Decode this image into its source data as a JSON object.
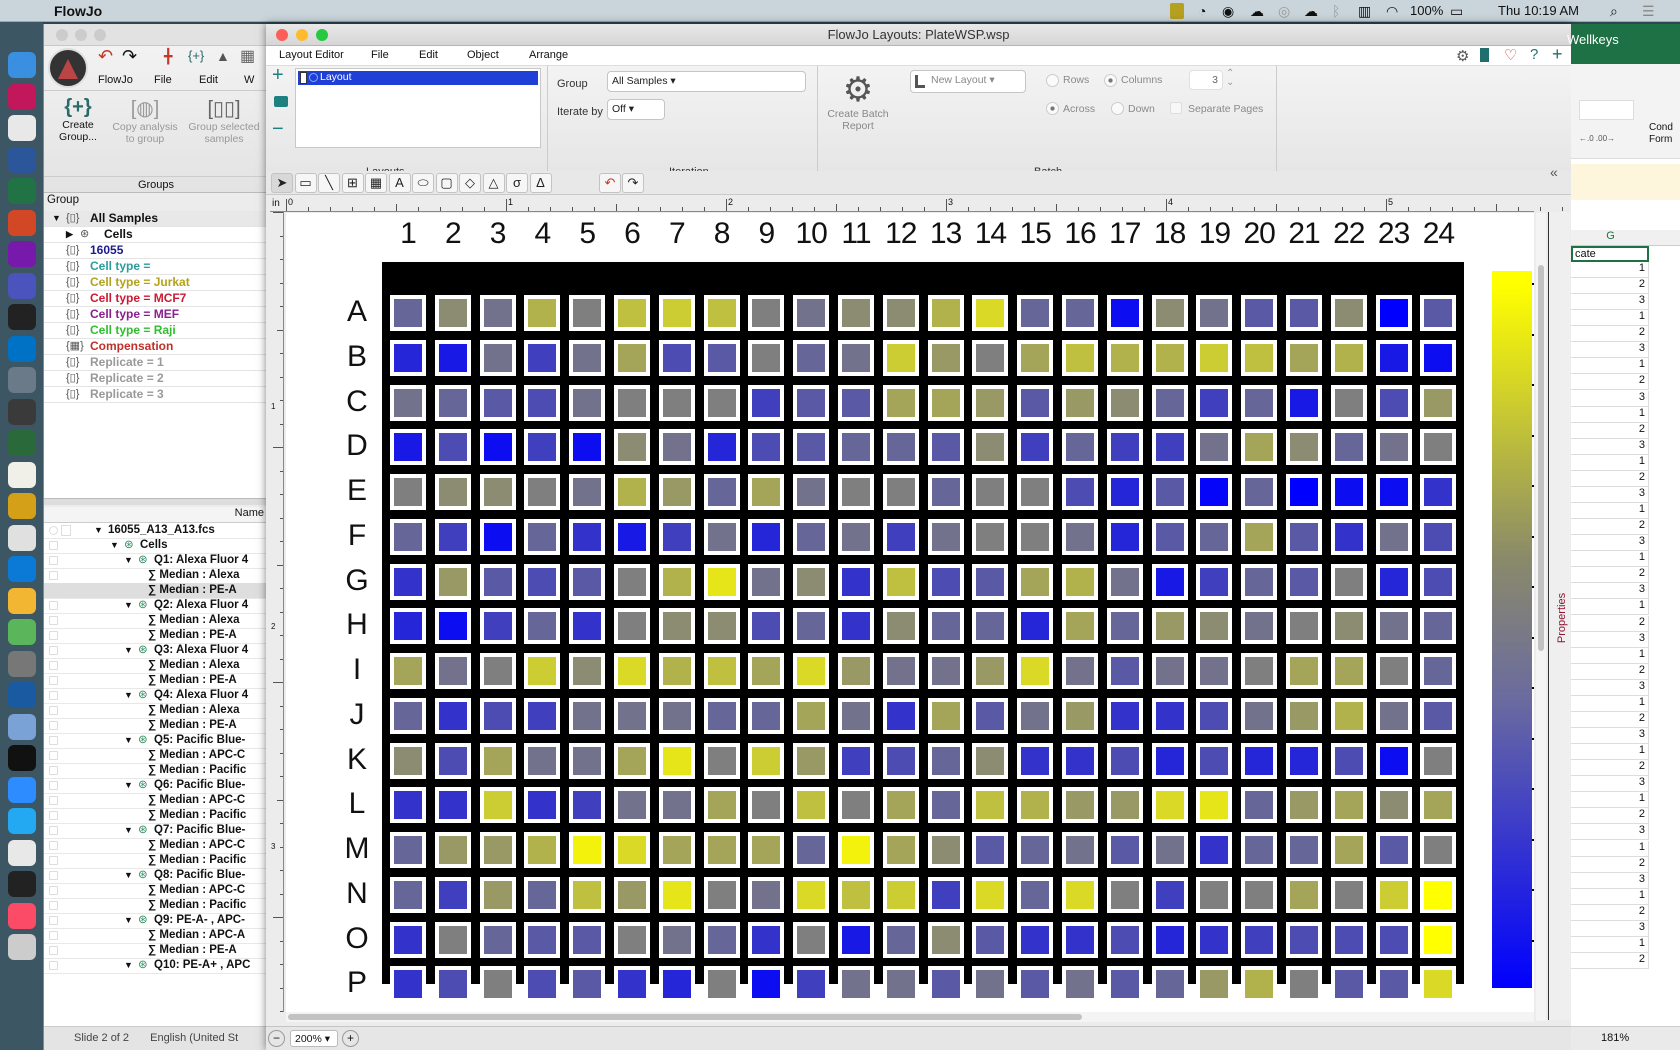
{
  "menubar": {
    "app_name": "FlowJo",
    "battery": "100%",
    "clock": "Thu 10:19 AM"
  },
  "dock": [
    {
      "name": "finder",
      "color": "#3b8fe0"
    },
    {
      "name": "heart-app",
      "color": "#c2185b"
    },
    {
      "name": "chrome",
      "color": "#e8e8e8"
    },
    {
      "name": "word",
      "color": "#2b579a"
    },
    {
      "name": "excel",
      "color": "#217346"
    },
    {
      "name": "powerpoint",
      "color": "#d24726"
    },
    {
      "name": "onenote",
      "color": "#7719aa"
    },
    {
      "name": "teams",
      "color": "#4b53bc"
    },
    {
      "name": "activity-monitor",
      "color": "#222"
    },
    {
      "name": "outlook",
      "color": "#0072c6"
    },
    {
      "name": "flowjo-stack",
      "color": "#6a7a88"
    },
    {
      "name": "flowjo",
      "color": "#3a3a3a"
    },
    {
      "name": "spreadsheet",
      "color": "#2a6a3a"
    },
    {
      "name": "notes",
      "color": "#f0f0e8"
    },
    {
      "name": "ubar",
      "color": "#d4a017"
    },
    {
      "name": "books",
      "color": "#e0e0e0"
    },
    {
      "name": "onedrive",
      "color": "#0a7ad6"
    },
    {
      "name": "photos",
      "color": "#f2b632"
    },
    {
      "name": "cloud",
      "color": "#5bb55a"
    },
    {
      "name": "system-preferences",
      "color": "#777"
    },
    {
      "name": "quicktime",
      "color": "#1a5aa0"
    },
    {
      "name": "r",
      "color": "#7aa2d6"
    },
    {
      "name": "terminal",
      "color": "#111"
    },
    {
      "name": "zoom",
      "color": "#2d8cff"
    },
    {
      "name": "vscode",
      "color": "#23a9f2"
    },
    {
      "name": "slack",
      "color": "#e8e8e8"
    },
    {
      "name": "acrobat",
      "color": "#222"
    },
    {
      "name": "music",
      "color": "#fb4b67"
    },
    {
      "name": "trash",
      "color": "#ccc"
    }
  ],
  "flowjo": {
    "menu": [
      "FlowJo",
      "File",
      "Edit",
      "W"
    ],
    "groups_ribbon": {
      "create": "Create Group...",
      "copy": "Copy analysis to group",
      "group_selected": "Group selected samples",
      "label": "Groups"
    },
    "group_header": "Group",
    "groups": [
      {
        "label": "All Samples",
        "color": "#111",
        "indent": 0,
        "arrow": "down",
        "icon": "group"
      },
      {
        "label": "Cells",
        "color": "#111",
        "indent": 1,
        "arrow": "right",
        "icon": "gate"
      },
      {
        "label": "16055",
        "color": "#1a1a8c",
        "indent": 0,
        "icon": "group"
      },
      {
        "label": "Cell type =",
        "color": "#2a9d9d",
        "indent": 0,
        "icon": "group"
      },
      {
        "label": "Cell type = Jurkat",
        "color": "#b3a21a",
        "indent": 0,
        "icon": "group"
      },
      {
        "label": "Cell type = MCF7",
        "color": "#cc1a33",
        "indent": 0,
        "icon": "group"
      },
      {
        "label": "Cell type = MEF",
        "color": "#8a1f8f",
        "indent": 0,
        "icon": "group"
      },
      {
        "label": "Cell type = Raji",
        "color": "#2fbf2f",
        "indent": 0,
        "icon": "group"
      },
      {
        "label": "Compensation",
        "color": "#c0302a",
        "indent": 0,
        "icon": "matrix"
      },
      {
        "label": "Replicate = 1",
        "color": "#999",
        "indent": 0,
        "icon": "group"
      },
      {
        "label": "Replicate = 2",
        "color": "#999",
        "indent": 0,
        "icon": "group"
      },
      {
        "label": "Replicate = 3",
        "color": "#999",
        "indent": 0,
        "icon": "group"
      }
    ],
    "sample_header": "Name",
    "samples": [
      {
        "label": "16055_A13_A13.fcs",
        "level": 0,
        "arrow": true
      },
      {
        "label": "Cells",
        "level": 1,
        "arrow": true,
        "gate": true
      },
      {
        "label": "Q1: Alexa Fluor 4",
        "level": 2,
        "arrow": true,
        "gate": true
      },
      {
        "label": "∑ Median : Alexa",
        "level": 3
      },
      {
        "label": "∑ Median : PE-A",
        "level": 3,
        "selected": true
      },
      {
        "label": "Q2: Alexa Fluor 4",
        "level": 2,
        "arrow": true,
        "gate": true
      },
      {
        "label": "∑ Median : Alexa",
        "level": 3
      },
      {
        "label": "∑ Median : PE-A",
        "level": 3
      },
      {
        "label": "Q3: Alexa Fluor 4",
        "level": 2,
        "arrow": true,
        "gate": true
      },
      {
        "label": "∑ Median : Alexa",
        "level": 3
      },
      {
        "label": "∑ Median : PE-A",
        "level": 3
      },
      {
        "label": "Q4: Alexa Fluor 4",
        "level": 2,
        "arrow": true,
        "gate": true
      },
      {
        "label": "∑ Median : Alexa",
        "level": 3
      },
      {
        "label": "∑ Median : PE-A",
        "level": 3
      },
      {
        "label": "Q5: Pacific Blue-",
        "level": 2,
        "arrow": true,
        "gate": true
      },
      {
        "label": "∑ Median : APC-C",
        "level": 3
      },
      {
        "label": "∑ Median : Pacific",
        "level": 3
      },
      {
        "label": "Q6: Pacific Blue-",
        "level": 2,
        "arrow": true,
        "gate": true
      },
      {
        "label": "∑ Median : APC-C",
        "level": 3
      },
      {
        "label": "∑ Median : Pacific",
        "level": 3
      },
      {
        "label": "Q7: Pacific Blue-",
        "level": 2,
        "arrow": true,
        "gate": true
      },
      {
        "label": "∑ Median : APC-C",
        "level": 3
      },
      {
        "label": "∑ Median : Pacific",
        "level": 3
      },
      {
        "label": "Q8: Pacific Blue-",
        "level": 2,
        "arrow": true,
        "gate": true
      },
      {
        "label": "∑ Median : APC-C",
        "level": 3
      },
      {
        "label": "∑ Median : Pacific",
        "level": 3
      },
      {
        "label": "Q9: PE-A- , APC-",
        "level": 2,
        "arrow": true,
        "gate": true
      },
      {
        "label": "∑ Median : APC-A",
        "level": 3
      },
      {
        "label": "∑ Median : PE-A",
        "level": 3
      },
      {
        "label": "Q10: PE-A+ , APC",
        "level": 2,
        "arrow": true,
        "gate": true
      }
    ],
    "status": {
      "slide": "Slide 2 of 2",
      "language": "English (United St"
    }
  },
  "layout_window": {
    "title": "FlowJo Layouts: PlateWSP.wsp",
    "menu": [
      "Layout Editor",
      "File",
      "Edit",
      "Object",
      "Arrange"
    ],
    "layouts": {
      "items": [
        "Layout"
      ],
      "label": "Layouts"
    },
    "iteration": {
      "group_label": "Group",
      "group_value": "All Samples ▾",
      "iterate_label": "Iterate by",
      "iterate_value": "Off ▾",
      "label": "Iteration"
    },
    "batch_report": "Create Batch Report",
    "batch": {
      "new_layout": "New Layout ▾",
      "rows": "Rows",
      "columns": "Columns",
      "count": "3",
      "across": "Across",
      "down": "Down",
      "separate_pages": "Separate Pages",
      "label": "Batch",
      "selected_orientation": "Columns",
      "selected_direction": "Across"
    },
    "tools": [
      {
        "name": "pointer",
        "g": "➤"
      },
      {
        "name": "rectangle",
        "g": "▭"
      },
      {
        "name": "line",
        "g": "╲"
      },
      {
        "name": "table",
        "g": "⊞"
      },
      {
        "name": "grid",
        "g": "▦"
      },
      {
        "name": "text",
        "g": "A"
      },
      {
        "name": "ellipse",
        "g": "⬭"
      },
      {
        "name": "rounded-rect",
        "g": "▢"
      },
      {
        "name": "diamond",
        "g": "◇"
      },
      {
        "name": "triangle",
        "g": "△"
      },
      {
        "name": "sigma",
        "g": "σ"
      },
      {
        "name": "delta",
        "g": "Δ"
      }
    ],
    "ruler": {
      "unit": "in",
      "marks": [
        "0",
        "1",
        "2",
        "3",
        "4",
        "5"
      ],
      "v_marks": [
        "1",
        "2",
        "3"
      ]
    },
    "properties_tab": "Properties",
    "zoom": "200%"
  },
  "plate": {
    "columns": [
      "1",
      "2",
      "3",
      "4",
      "5",
      "6",
      "7",
      "8",
      "9",
      "10",
      "11",
      "12",
      "13",
      "14",
      "15",
      "16",
      "17",
      "18",
      "19",
      "20",
      "21",
      "22",
      "23",
      "24"
    ],
    "rows": [
      "A",
      "B",
      "C",
      "D",
      "E",
      "F",
      "G",
      "H",
      "I",
      "J",
      "K",
      "L",
      "M",
      "N",
      "O",
      "P"
    ],
    "scale": {
      "min_color": "#0000ff",
      "mid_color": "#7f7f7f",
      "max_color": "#ffff00",
      "range": [
        0,
        10
      ]
    },
    "values": [
      [
        4,
        5.5,
        4.5,
        7,
        5,
        7.5,
        8,
        7.5,
        5,
        4.5,
        5.5,
        5.5,
        7,
        8.5,
        4,
        4,
        0.5,
        5.5,
        4.5,
        3.5,
        3.5,
        5.5,
        0,
        3.5
      ],
      [
        1.5,
        1,
        4.5,
        2.5,
        4.5,
        6.5,
        3,
        3.5,
        5,
        4,
        4.5,
        8,
        6,
        5,
        6.5,
        7.5,
        7,
        7,
        8,
        7.5,
        6.5,
        7,
        1,
        0.5
      ],
      [
        4.5,
        4,
        3.5,
        3,
        4.5,
        5,
        5,
        5,
        2.5,
        3.5,
        3.5,
        6.5,
        6.5,
        6,
        3.5,
        6,
        5.5,
        4,
        2.5,
        4,
        1,
        5,
        3,
        6
      ],
      [
        1,
        3,
        0.5,
        2.5,
        0.5,
        5.5,
        4.5,
        1.5,
        3,
        3.5,
        4,
        4,
        3.5,
        5.5,
        2.5,
        4,
        2.5,
        2.5,
        4.5,
        6.5,
        5.5,
        4,
        4.5,
        5
      ],
      [
        5,
        5.5,
        5.5,
        5,
        4.5,
        7,
        6,
        4,
        6.5,
        4.5,
        5,
        5,
        4,
        5,
        5,
        3,
        1.5,
        3.5,
        0.2,
        4,
        0,
        0.5,
        0.5,
        2
      ],
      [
        4,
        2.5,
        0.5,
        4,
        2,
        1,
        2.5,
        4.5,
        1.5,
        4,
        4.5,
        2.5,
        4.5,
        5,
        5,
        4.5,
        1.5,
        3.5,
        4,
        6.5,
        3.5,
        2,
        4.5,
        3
      ],
      [
        2,
        6,
        3.5,
        3,
        3.5,
        5,
        7,
        9,
        4.5,
        5.5,
        2,
        7.5,
        3,
        3.5,
        6.5,
        7,
        4.5,
        1,
        2.5,
        4,
        3.5,
        5,
        1.5,
        3
      ],
      [
        1.5,
        0.5,
        2.5,
        4,
        2,
        5,
        5.5,
        5.5,
        3,
        4,
        2,
        5.5,
        4,
        4,
        1.5,
        6.5,
        4,
        6,
        5.5,
        4.5,
        5,
        5.5,
        4.5,
        4
      ],
      [
        6.5,
        4.5,
        5,
        8,
        5.5,
        8.5,
        7,
        7.5,
        6.5,
        8.5,
        6,
        4.5,
        4.5,
        6,
        8.5,
        4.5,
        3.5,
        4.5,
        4.5,
        5,
        6.5,
        6.5,
        5,
        4
      ],
      [
        4,
        2,
        3,
        2.5,
        4.5,
        4.5,
        4.5,
        4,
        4,
        6.5,
        4.5,
        2,
        6.5,
        3.5,
        4.5,
        6,
        2,
        2,
        3,
        4.5,
        6,
        7,
        4.5,
        3.5
      ],
      [
        5.5,
        3,
        6.5,
        4.5,
        4.5,
        6.5,
        9,
        5,
        8,
        6,
        2.5,
        3,
        4,
        5.5,
        2,
        2,
        3,
        1.5,
        3,
        1.5,
        1.5,
        3,
        0.5,
        5
      ],
      [
        2,
        2,
        8,
        2,
        2.5,
        4.5,
        4.5,
        6.5,
        5,
        7.5,
        5,
        6.5,
        4,
        7.5,
        7,
        6,
        6,
        8.5,
        9,
        4,
        6,
        6.5,
        5.5,
        6.5
      ],
      [
        4,
        6,
        6,
        7,
        9.5,
        8.5,
        6.5,
        6.5,
        6.5,
        4,
        9.5,
        6.5,
        5.5,
        3.5,
        4,
        4.5,
        3.5,
        4.5,
        2,
        4,
        4,
        6.5,
        3.5,
        5
      ],
      [
        4,
        2.5,
        6,
        4,
        7.5,
        6,
        9,
        5,
        4.5,
        8.5,
        7.5,
        8,
        2.5,
        8.5,
        4,
        8.5,
        5,
        2.5,
        5,
        5,
        6.5,
        5,
        8,
        10
      ],
      [
        2,
        5,
        4,
        3.5,
        3.5,
        5,
        4.5,
        4,
        2,
        5,
        1,
        4,
        5.5,
        3.5,
        2,
        2,
        3,
        1.5,
        2,
        2.5,
        3,
        3,
        3,
        10
      ],
      [
        2,
        3,
        5,
        3,
        3.5,
        2,
        1.5,
        5,
        0.5,
        2.5,
        4.5,
        4.5,
        3.5,
        4.5,
        3.5,
        4.5,
        3.5,
        4,
        6,
        7,
        5,
        3.5,
        3.5,
        8.5
      ]
    ]
  },
  "excel": {
    "title": "Wellkeys",
    "column": "G",
    "header_cell": "cate",
    "ribbon_label": "Cond Form",
    "zoom": "181%",
    "values": [
      "1",
      "2",
      "3",
      "1",
      "2",
      "3",
      "1",
      "2",
      "3",
      "1",
      "2",
      "3",
      "1",
      "2",
      "3",
      "1",
      "2",
      "3",
      "1",
      "2",
      "3",
      "1",
      "2",
      "3",
      "1",
      "2",
      "3",
      "1",
      "2",
      "3",
      "1",
      "2",
      "3",
      "1",
      "2",
      "3",
      "1",
      "2",
      "3",
      "1",
      "2",
      "3",
      "1",
      "2"
    ]
  }
}
